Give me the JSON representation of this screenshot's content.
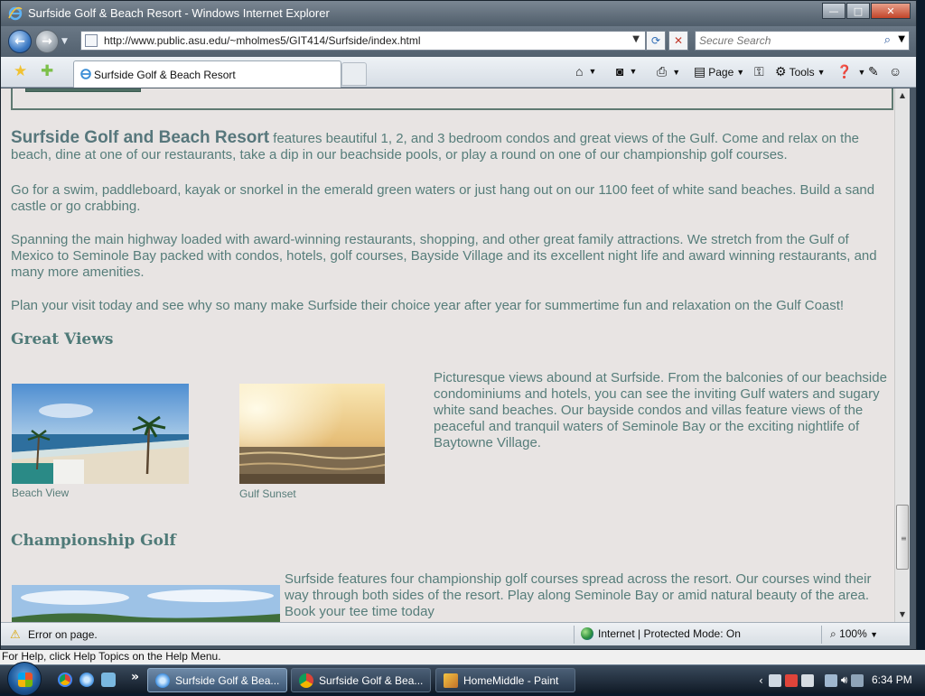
{
  "window": {
    "title": "Surfside Golf & Beach Resort - Windows Internet Explorer"
  },
  "address_bar": {
    "url": "http://www.public.asu.edu/~mholmes5/GIT414/Surfside/index.html",
    "search_placeholder": "Secure Search"
  },
  "tabs": [
    {
      "label": "Surfside Golf & Beach Resort"
    }
  ],
  "commands": {
    "page": "Page",
    "tools": "Tools"
  },
  "page": {
    "intro_lead": "Surfside Golf and Beach Resort",
    "intro_rest": " features beautiful 1, 2, and 3 bedroom condos and great views of the Gulf. Come and relax on the beach, dine at one of our restaurants, take a dip in our beachside pools, or play a round on one of our championship golf courses.",
    "para2": "Go for a swim, paddleboard, kayak or snorkel in the emerald green waters or just hang out on our 1100 feet of white sand beaches. Build a sand castle or go crabbing.",
    "para3": "Spanning the main highway loaded with award-winning restaurants, shopping, and other great family attractions. We stretch from the Gulf of Mexico to Seminole Bay packed with condos, hotels, golf courses, Bayside Village and its excellent night life and award winning restaurants, and many more amenities.",
    "para4": "Plan your visit today and see why so many make Surfside their choice year after year for summertime fun and relaxation on the Gulf Coast!",
    "views_heading": "Great Views",
    "caption_beach": "Beach View",
    "caption_sunset": "Gulf Sunset",
    "views_text": "Picturesque views abound at Surfside. From the balconies of our beachside condominiums and hotels, you can see the inviting Gulf waters and sugary white sand beaches. Our bayside condos and villas feature views of the peaceful and tranquil waters of Seminole Bay or the exciting nightlife of Baytowne Village.",
    "golf_heading": "Championship Golf",
    "golf_text": "Surfside features four championship golf courses spread across the resort. Our courses wind their way through both sides of the resort. Play along Seminole Bay or amid natural beauty of the area. Book your tee time today"
  },
  "statusbar": {
    "message": "Error on page.",
    "zone": "Internet | Protected Mode: On",
    "zoom": "100%"
  },
  "helpline": "For Help, click Help Topics on the Help Menu.",
  "taskbar": {
    "tasks": [
      {
        "label": "Surfside Golf & Bea..."
      },
      {
        "label": "Surfside Golf & Bea..."
      },
      {
        "label": "HomeMiddle - Paint"
      }
    ],
    "clock": "6:34 PM"
  },
  "colors": {
    "content_bg": "#e8e4e3",
    "text": "#567d7a",
    "heading": "#4f7a78",
    "frame": "#5f7a72"
  }
}
